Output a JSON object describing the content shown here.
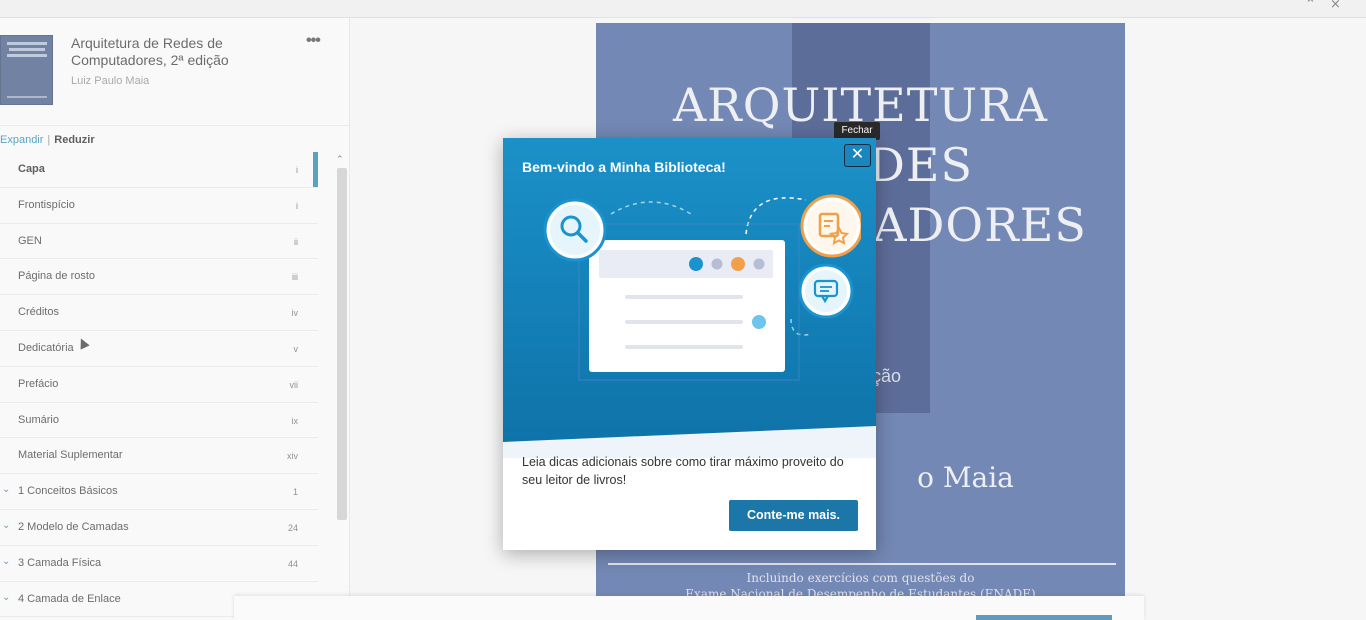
{
  "book": {
    "title": "Arquitetura de Redes de Computadores, 2ª edição",
    "author": "Luiz Paulo Maia",
    "more_label": "•••"
  },
  "toc_controls": {
    "expand": "Expandir",
    "separator": "|",
    "reduce": "Reduzir"
  },
  "toc": [
    {
      "label": "Capa",
      "page": "i",
      "active": true
    },
    {
      "label": "Frontispício",
      "page": "i"
    },
    {
      "label": "GEN",
      "page": "ii"
    },
    {
      "label": "Página de rosto",
      "page": "iii"
    },
    {
      "label": "Créditos",
      "page": "iv"
    },
    {
      "label": "Dedicatória",
      "page": "v"
    },
    {
      "label": "Prefácio",
      "page": "vii"
    },
    {
      "label": "Sumário",
      "page": "ix"
    },
    {
      "label": "Material Suplementar",
      "page": "xiv"
    },
    {
      "label": "1 Conceitos Básicos",
      "page": "1",
      "chevron": "⌄"
    },
    {
      "label": "2 Modelo de Camadas",
      "page": "24",
      "chevron": "⌄"
    },
    {
      "label": "3 Camada Física",
      "page": "44",
      "chevron": "⌄"
    },
    {
      "label": "4 Camada de Enlace",
      "page": "",
      "chevron": "⌄"
    }
  ],
  "page_cover": {
    "title_line1": "ARQUITETURA",
    "title_line2": "DES",
    "title_line3": "TADORES",
    "edition_fragment": "ção",
    "author_fragment": "o Maia",
    "note_line1": "Incluindo exercícios com questões do",
    "note_line2": "Exame Nacional de Desempenho de Estudantes (ENADE)"
  },
  "modal": {
    "title": "Bem-vindo a Minha Biblioteca!",
    "close_symbol": "✕",
    "close_tooltip": "Fechar",
    "body": "Leia dicas adicionais sobre como tirar máximo proveito do seu leitor de livros!",
    "cta_label": "Conte-me mais."
  },
  "colors": {
    "accent": "#1c76a8",
    "modal_hero": "#1b91c8",
    "cover_blue": "#3d5a98",
    "illus_orange": "#f0a04b"
  }
}
